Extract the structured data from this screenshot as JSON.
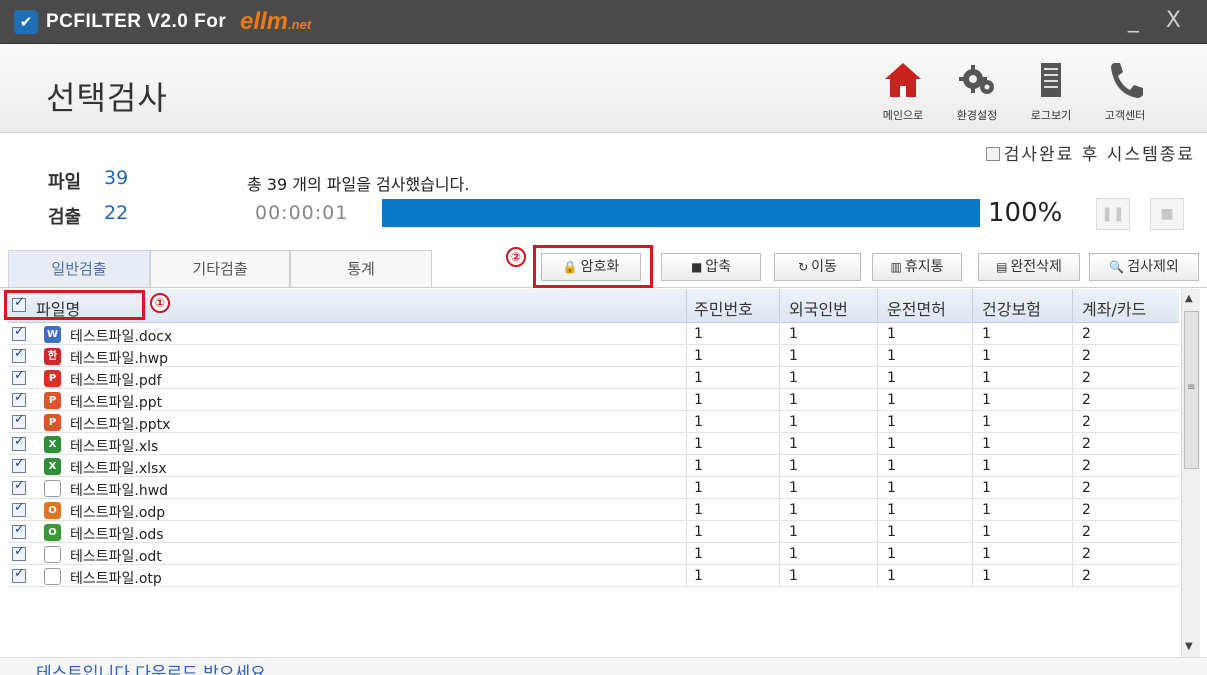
{
  "window": {
    "app_icon": "shield-icon",
    "title": "PCFILTER V2.0 For",
    "brand": "ellm",
    "brand_suffix": ".net",
    "window_buttons": "_ X"
  },
  "header": {
    "page_title": "선택검사",
    "toolbar": [
      {
        "label": "메인으로",
        "icon": "home-icon"
      },
      {
        "label": "환경설정",
        "icon": "gear-icon"
      },
      {
        "label": "로그보기",
        "icon": "log-icon"
      },
      {
        "label": "고객센터",
        "icon": "phone-icon"
      }
    ],
    "shutdown_label": "검사완료 후 시스템종료"
  },
  "stats": {
    "files_label": "파일",
    "files_value": "39",
    "detected_label": "검출",
    "detected_value": "22",
    "message": "총 39 개의 파일을 검사했습니다.",
    "elapsed": "00:00:01",
    "progress": 1.0,
    "percent": "100%"
  },
  "tabs": [
    "일반검출",
    "기타검출",
    "통계"
  ],
  "actions": [
    {
      "label": "암호화",
      "icon": "lock-icon"
    },
    {
      "label": "압축",
      "icon": "folder-icon"
    },
    {
      "label": "이동",
      "icon": "move-icon"
    },
    {
      "label": "휴지통",
      "icon": "trash-icon"
    },
    {
      "label": "완전삭제",
      "icon": "shred-icon"
    },
    {
      "label": "검사제외",
      "icon": "search-icon"
    }
  ],
  "annotations": {
    "one": "①",
    "two": "②"
  },
  "table": {
    "columns": [
      "파일명",
      "주민번호",
      "외국인번",
      "운전면허",
      "건강보험",
      "계좌/카드"
    ],
    "rows": [
      {
        "name": "테스트파일.docx",
        "icon": "word-icon",
        "color": "#3b6fc4",
        "glyph": "W",
        "vals": [
          "1",
          "1",
          "1",
          "1",
          "2"
        ]
      },
      {
        "name": "테스트파일.hwp",
        "icon": "hwp-icon",
        "color": "#cc2a2a",
        "glyph": "한",
        "vals": [
          "1",
          "1",
          "1",
          "1",
          "2"
        ]
      },
      {
        "name": "테스트파일.pdf",
        "icon": "pdf-icon",
        "color": "#d93025",
        "glyph": "P",
        "vals": [
          "1",
          "1",
          "1",
          "1",
          "2"
        ]
      },
      {
        "name": "테스트파일.ppt",
        "icon": "powerpoint-icon",
        "color": "#d9562b",
        "glyph": "P",
        "vals": [
          "1",
          "1",
          "1",
          "1",
          "2"
        ]
      },
      {
        "name": "테스트파일.pptx",
        "icon": "powerpoint-icon",
        "color": "#d9562b",
        "glyph": "P",
        "vals": [
          "1",
          "1",
          "1",
          "1",
          "2"
        ]
      },
      {
        "name": "테스트파일.xls",
        "icon": "excel-icon",
        "color": "#2f8f3a",
        "glyph": "X",
        "vals": [
          "1",
          "1",
          "1",
          "1",
          "2"
        ]
      },
      {
        "name": "테스트파일.xlsx",
        "icon": "excel-icon",
        "color": "#2f8f3a",
        "glyph": "X",
        "vals": [
          "1",
          "1",
          "1",
          "1",
          "2"
        ]
      },
      {
        "name": "테스트파일.hwd",
        "icon": "blank-file-icon",
        "color": "",
        "glyph": "",
        "vals": [
          "1",
          "1",
          "1",
          "1",
          "2"
        ]
      },
      {
        "name": "테스트파일.odp",
        "icon": "impress-icon",
        "color": "#e0751f",
        "glyph": "O",
        "vals": [
          "1",
          "1",
          "1",
          "1",
          "2"
        ]
      },
      {
        "name": "테스트파일.ods",
        "icon": "calc-icon",
        "color": "#3a9a3a",
        "glyph": "O",
        "vals": [
          "1",
          "1",
          "1",
          "1",
          "2"
        ]
      },
      {
        "name": "테스트파일.odt",
        "icon": "text-file-icon",
        "color": "",
        "glyph": "",
        "vals": [
          "1",
          "1",
          "1",
          "1",
          "2"
        ]
      },
      {
        "name": "테스트파일.otp",
        "icon": "blank-file-icon",
        "color": "",
        "glyph": "",
        "vals": [
          "1",
          "1",
          "1",
          "1",
          "2"
        ]
      }
    ]
  },
  "footer": {
    "message": "테스트입니다 다운로드 받으세요"
  }
}
